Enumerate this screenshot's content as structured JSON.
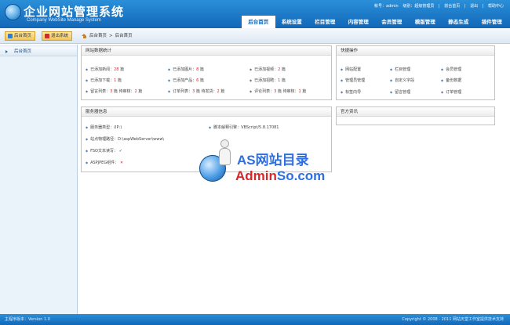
{
  "header": {
    "title": "企业网站管理系统",
    "subtitle": "Company WebSite Manage System",
    "top_links": [
      "帐号：admin",
      "级别：超级管理员",
      "前台首页",
      "退出",
      "帮助中心"
    ],
    "nav": [
      "后台首页",
      "系统设置",
      "栏目管理",
      "内容管理",
      "会员管理",
      "模版管理",
      "静态生成",
      "插件管理"
    ],
    "active_nav": "后台首页"
  },
  "toolbar": {
    "home_button": "后台首页",
    "logout_button": "退出系统",
    "breadcrumb": [
      "后台首页",
      "后台首页"
    ]
  },
  "sidebar": {
    "items": [
      "后台首页"
    ]
  },
  "stats_panel": {
    "title": "网站数据统计",
    "rows": [
      [
        {
          "label": "已添加新闻：",
          "value": "28",
          "unit": "篇"
        },
        {
          "label": "已添加图片：",
          "value": "8",
          "unit": "篇"
        },
        {
          "label": "已添加视频：",
          "value": "2",
          "unit": "篇"
        }
      ],
      [
        {
          "label": "已添加下载：",
          "value": "1",
          "unit": "篇"
        },
        {
          "label": "已添加产品：",
          "value": "6",
          "unit": "篇"
        },
        {
          "label": "已添加招聘：",
          "value": "1",
          "unit": "篇"
        }
      ],
      [
        {
          "label": "留言列表：",
          "value": "3",
          "unit": "篇",
          "label2": "待审核：",
          "value2": "2",
          "unit2": "篇"
        },
        {
          "label": "订单列表：",
          "value": "3",
          "unit": "篇",
          "label2": "待发货：",
          "value2": "2",
          "unit2": "篇"
        },
        {
          "label": "评论列表：",
          "value": "3",
          "unit": "篇",
          "label2": "待审核：",
          "value2": "1",
          "unit2": "篇"
        }
      ]
    ]
  },
  "quick_panel": {
    "title": "快捷操作",
    "items": [
      "网站配置",
      "栏目管理",
      "会员管理",
      "管理员管理",
      "自定义字段",
      "备份数据",
      "标签向导",
      "留言管理",
      "订单管理"
    ]
  },
  "server_panel": {
    "title": "服务器信息",
    "server_type_label": "服务器类型：",
    "server_type_value": "(IP:)",
    "script_engine_label": "脚本解释引擎：",
    "script_engine_value": "VBScript/5.8.17081",
    "site_path_label": "站点物理路径：",
    "site_path_value": "D:\\aspWebServer\\www\\",
    "fso_label": "FSO文本读写：",
    "fso_status": "✓",
    "jpeg_label": "ASPJPEG组件：",
    "jpeg_status": "✕"
  },
  "news_panel": {
    "title": "官方资讯"
  },
  "footer": {
    "version": "主程序版本：Version 1.0",
    "copyright": "Copyright © 2008 - 2011 网站天堂工作室提供技术支持"
  },
  "watermark": {
    "line1": "AS网站目录",
    "line2_a": "Admin",
    "line2_b": "So.com"
  }
}
